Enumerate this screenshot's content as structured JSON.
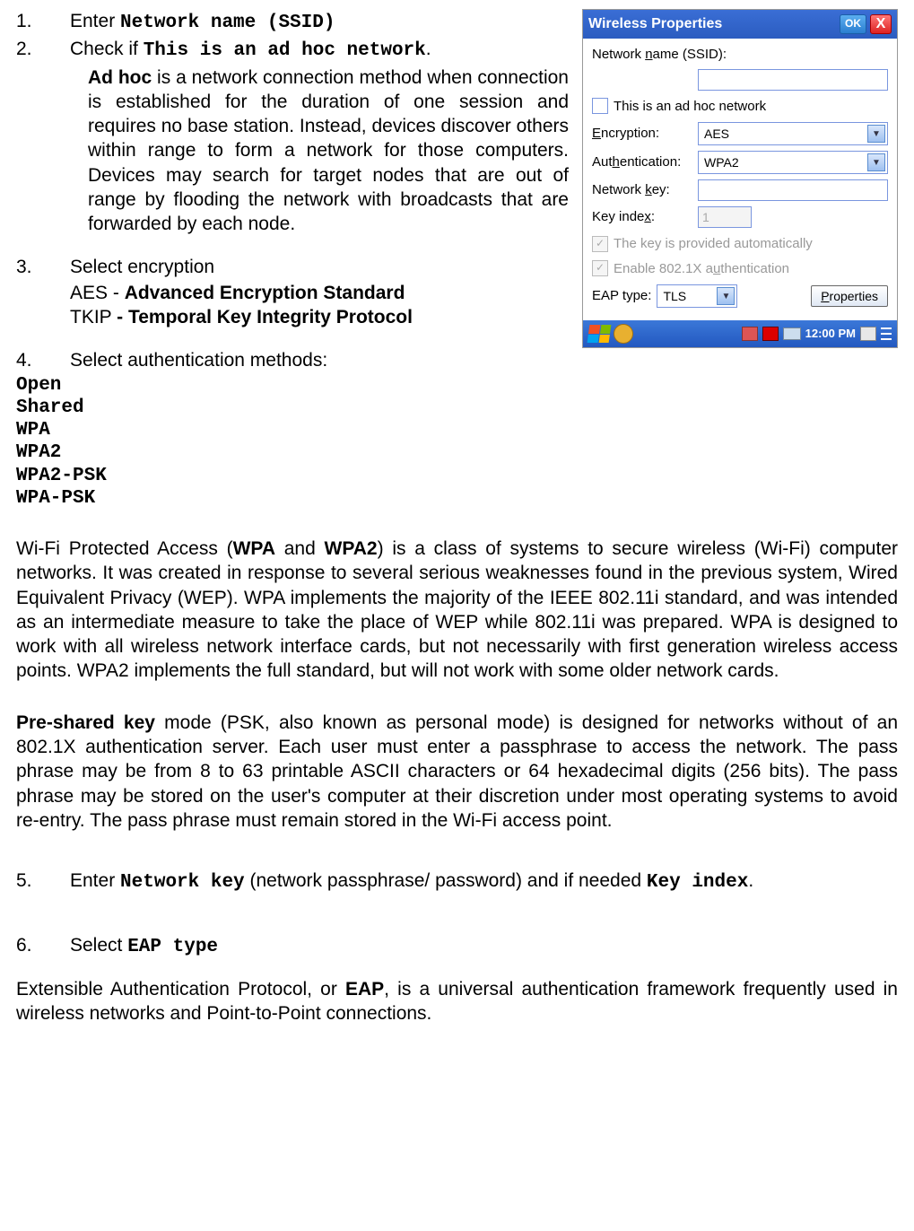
{
  "steps": {
    "s1": {
      "num": "1.",
      "prefix": "Enter ",
      "code": "Network name (SSID)"
    },
    "s2": {
      "num": "2.",
      "prefix": "Check if ",
      "code": "This is an ad hoc network",
      "suffix": "."
    },
    "adhoc_desc": "Ad hoc is a network connection method when connection is established for the duration of one session and requires no base station. Instead, devices discover others within range to form a network for those computers. Devices may search for target nodes that are out of range by flooding the network with broadcasts that are forwarded by each node.",
    "adhoc_bold": "Ad hoc",
    "s3": {
      "num": "3.",
      "text": " Select encryption"
    },
    "s3_a": {
      "pre": "AES - ",
      "bold": "Advanced Encryption Standard"
    },
    "s3_b": {
      "pre": "TKIP ",
      "bold": "- Temporal Key Integrity Protocol"
    },
    "s4": {
      "num": "4.",
      "text": " Select authentication methods:"
    },
    "auth": [
      "Open",
      "Shared",
      "WPA",
      "WPA2",
      "WPA2-PSK",
      "WPA-PSK"
    ],
    "s5": {
      "num": "5.",
      "prefix": "Enter ",
      "code1": "Network key",
      "mid": " (network passphrase/ password) and if needed ",
      "code2": "Key index",
      "suffix": "."
    },
    "s6": {
      "num": "6.",
      "prefix": "Select ",
      "code": "EAP type"
    }
  },
  "wpa_para_pre": "Wi-Fi Protected Access (",
  "wpa_b1": "WPA",
  "wpa_mid": " and ",
  "wpa_b2": "WPA2",
  "wpa_para_post": ") is a class of systems to secure wireless (Wi-Fi) computer networks. It was created in response to several serious weaknesses found in the previous system, Wired Equivalent Privacy (WEP). WPA implements the majority of the IEEE 802.11i standard, and was intended as an intermediate measure to take the place of WEP while 802.11i was prepared. WPA is designed to work with all wireless network interface cards, but not necessarily with first generation wireless access points. WPA2 implements the full standard, but will not work with some older network cards.",
  "psk_b": "Pre-shared key",
  "psk_para": " mode (PSK, also known as personal mode) is designed for networks without of an 802.1X authentication server. Each user must enter a passphrase to access the network. The pass phrase may be from 8 to 63 printable ASCII characters or 64 hexadecimal digits (256 bits). The pass phrase may be stored on the user's computer at their discretion under most operating systems to avoid re-entry. The pass phrase must remain stored in the Wi-Fi access point.",
  "eap_pre": "Extensible Authentication Protocol, or ",
  "eap_b": "EAP",
  "eap_post": ", is a universal authentication framework frequently used in wireless networks and Point-to-Point connections.",
  "dialog": {
    "title": "Wireless Properties",
    "ok": "OK",
    "close": "X",
    "ssid_label_pre": "Network ",
    "ssid_label_u": "n",
    "ssid_label_post": "ame (SSID):",
    "ssid_value": "",
    "adhoc_label": "This is an ad hoc network",
    "enc_label_u": "E",
    "enc_label_post": "ncryption:",
    "enc_value": "AES",
    "auth_label_pre": "Aut",
    "auth_label_u": "h",
    "auth_label_post": "entication:",
    "auth_value": "WPA2",
    "key_label_pre": "Network ",
    "key_label_u": "k",
    "key_label_post": "ey:",
    "key_value": "",
    "idx_label_pre": "Key inde",
    "idx_label_u": "x",
    "idx_label_post": ":",
    "idx_value": "1",
    "auto_key": "The key is provided automatically",
    "enable_pre": "Enable 802.1X a",
    "enable_u": "u",
    "enable_post": "thentication",
    "eap_label": "EAP type:",
    "eap_value": "TLS",
    "props_u": "P",
    "props_post": "roperties",
    "time": "12:00 PM"
  }
}
